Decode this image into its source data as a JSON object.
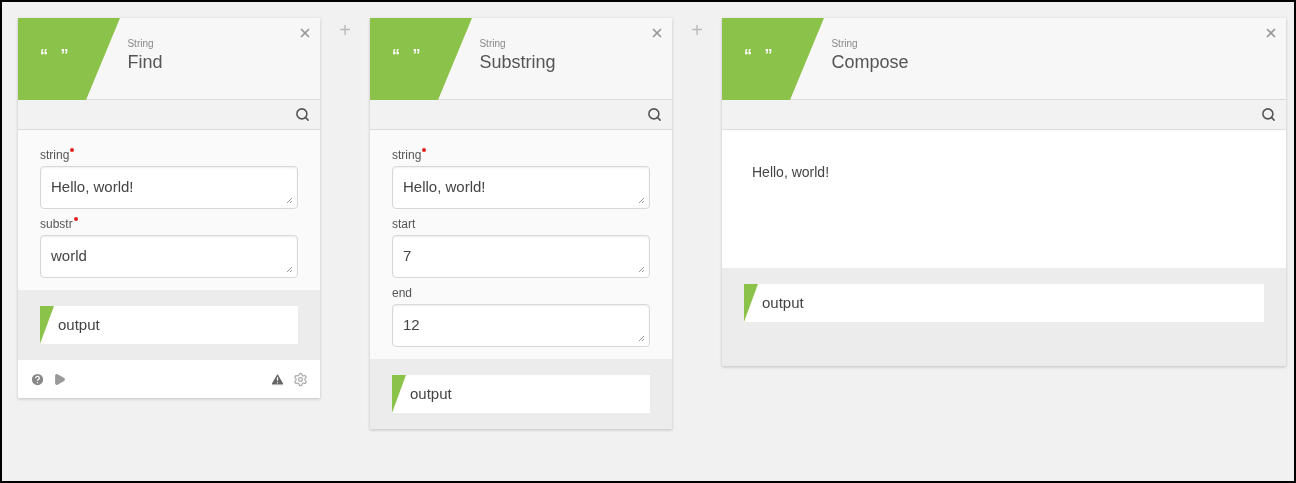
{
  "nodes": [
    {
      "icon": "“ ”",
      "category": "String",
      "title": "Find",
      "kind": "fields",
      "fields": [
        {
          "label": "string",
          "required": true,
          "value": "Hello, world!"
        },
        {
          "label": "substr",
          "required": true,
          "value": "world"
        }
      ],
      "output": "output",
      "footer": true
    },
    {
      "icon": "“ ”",
      "category": "String",
      "title": "Substring",
      "kind": "fields",
      "fields": [
        {
          "label": "string",
          "required": true,
          "value": "Hello, world!"
        },
        {
          "label": "start",
          "required": false,
          "value": "7"
        },
        {
          "label": "end",
          "required": false,
          "value": "12"
        }
      ],
      "output": "output",
      "footer": false
    },
    {
      "icon": "“ ”",
      "category": "String",
      "title": "Compose",
      "kind": "text",
      "text": "Hello, world!",
      "output": "output",
      "footer": false
    }
  ],
  "add_buttons": [
    "+",
    "+"
  ]
}
